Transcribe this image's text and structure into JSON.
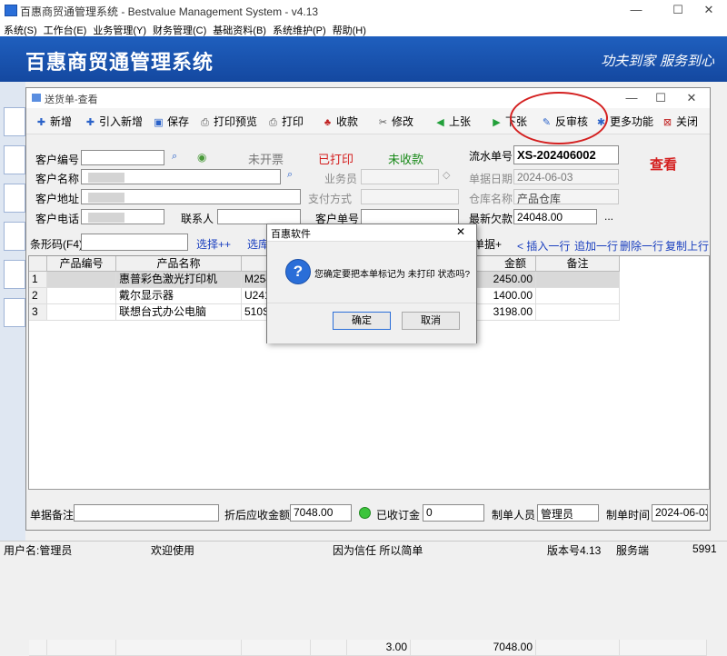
{
  "window": {
    "title": "百惠商贸通管理系统 - Bestvalue Management System - v4.13",
    "minimize": "—",
    "maximize": "☐",
    "close": "✕"
  },
  "menu": [
    "系统(S)",
    "工作台(E)",
    "业务管理(Y)",
    "财务管理(C)",
    "基础资料(B)",
    "系统维护(P)",
    "帮助(H)"
  ],
  "banner": {
    "title": "百惠商贸通管理系统",
    "slogan": "功夫到家 服务到心"
  },
  "child": {
    "title": "送货单-查看",
    "mode_label": "查看"
  },
  "toolbar": [
    {
      "label": "新增",
      "icon": "plus-icon",
      "glyph": "✚",
      "color": "#2a62c9"
    },
    {
      "label": "引入新增",
      "icon": "import-add-icon",
      "glyph": "✚",
      "color": "#2a62c9"
    },
    {
      "label": "保存",
      "icon": "save-icon",
      "glyph": "▣",
      "color": "#2a62c9"
    },
    {
      "label": "打印预览",
      "icon": "print-preview-icon",
      "glyph": "⎙",
      "color": "#555555"
    },
    {
      "label": "打印",
      "icon": "print-icon",
      "glyph": "⎙",
      "color": "#555555"
    },
    {
      "label": "收款",
      "icon": "receive-money-icon",
      "glyph": "♣",
      "color": "#c02020"
    },
    {
      "label": "修改",
      "icon": "edit-icon",
      "glyph": "✂",
      "color": "#555555"
    },
    {
      "label": "上张",
      "icon": "previous-icon",
      "glyph": "◀",
      "color": "#22a03a"
    },
    {
      "label": "下张",
      "icon": "next-icon",
      "glyph": "▶",
      "color": "#22a03a"
    },
    {
      "label": "反审核",
      "icon": "unapprove-icon",
      "glyph": "✎",
      "color": "#2a62c9"
    },
    {
      "label": "更多功能",
      "icon": "more-functions-icon",
      "glyph": "✱",
      "color": "#2a62c9"
    },
    {
      "label": "关闭",
      "icon": "close-icon",
      "glyph": "⊠",
      "color": "#c02020"
    }
  ],
  "form": {
    "customer_code_label": "客户编号",
    "customer_name_label": "客户名称",
    "customer_address_label": "客户地址",
    "customer_phone_label": "客户电话",
    "contact_label": "联系人",
    "status_invoice": "未开票",
    "status_printed": "已打印",
    "status_payment": "未收款",
    "salesperson_label": "业务员",
    "payment_method_label": "支付方式",
    "customer_order_label": "客户单号",
    "serial_label": "流水单号",
    "serial_value": "XS-202406002",
    "date_label": "单据日期",
    "date_value": "2024-06-03",
    "warehouse_label": "仓库名称",
    "warehouse_value": "产品仓库",
    "latest_debt_label": "最新欠款",
    "latest_debt_value": "24048.00",
    "ellipsis": "..."
  },
  "barcode": {
    "label": "条形码(F4)",
    "select_plus": "选择++",
    "select_lib": "选库",
    "doc_plus": "单据+",
    "insert_row": "< 插入一行",
    "append_row": "追加一行",
    "delete_row": "删除一行",
    "copy_row": "复制上行"
  },
  "grid": {
    "headers": [
      "",
      "产品编号",
      "产品名称",
      "型号",
      "金额",
      "备注"
    ],
    "rows": [
      {
        "no": "1",
        "code": "",
        "name": "惠普彩色激光打印机",
        "model": "M254",
        "amount": "2450.00",
        "note": ""
      },
      {
        "no": "2",
        "code": "",
        "name": "戴尔显示器",
        "model": "U2417",
        "amount": "1400.00",
        "note": ""
      },
      {
        "no": "3",
        "code": "",
        "name": "联想台式办公电脑",
        "model": "510S",
        "amount": "3198.00",
        "note": ""
      }
    ],
    "total_qty": "3.00",
    "total_amount": "7048.00"
  },
  "footer": {
    "remark_label": "单据备注",
    "discount_label": "折后应收金额",
    "discount_value": "7048.00",
    "deposit_label": "已收订金",
    "deposit_value": "0",
    "creator_label": "制单人员",
    "creator_value": "管理员",
    "create_time_label": "制单时间",
    "create_time_value": "2024-06-03"
  },
  "dialog": {
    "title": "百惠软件",
    "message": "您确定要把本单标记为 未打印 状态吗?",
    "ok": "确定",
    "cancel": "取消",
    "close": "✕"
  },
  "statusbar": {
    "user": "用户名:管理员",
    "welcome": "欢迎使用",
    "motto": "因为信任 所以简单",
    "version": "版本号4.13",
    "server": "服务端",
    "code": "5991"
  },
  "colors": {
    "banner": "#1f5fbe",
    "status_printed": "#d42020",
    "status_payment": "#1a8a1a",
    "annotation": "#d42020"
  }
}
